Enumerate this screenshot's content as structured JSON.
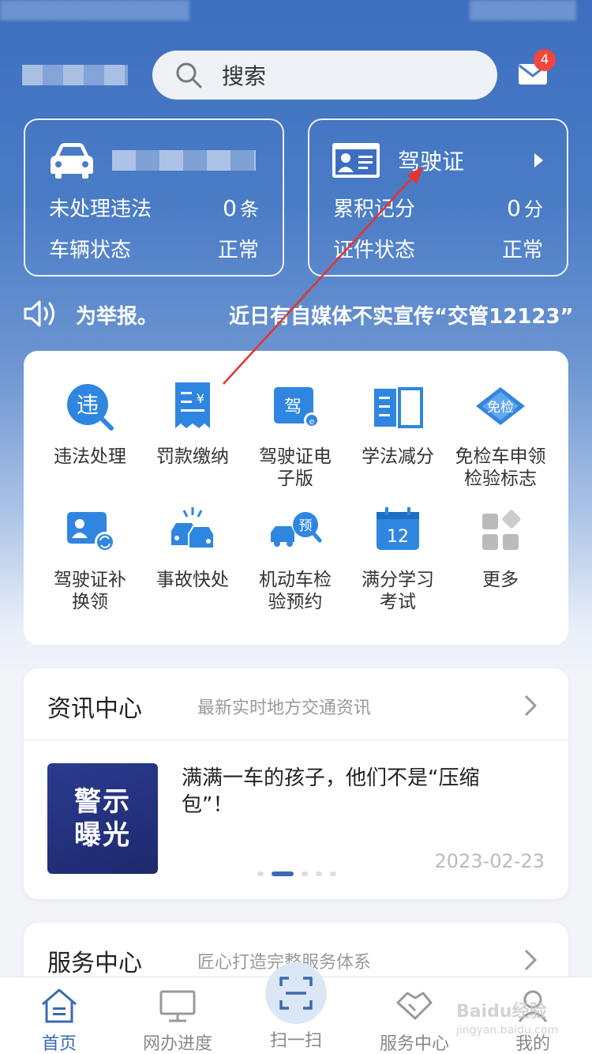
{
  "header": {
    "search_placeholder": "搜索",
    "mail_badge_count": "4"
  },
  "vehicle_card": {
    "violations_label": "未处理违法",
    "violations_count": "0",
    "violations_unit": "条",
    "status_label": "车辆状态",
    "status_value": "正常"
  },
  "license_card": {
    "title": "驾驶证",
    "points_label": "累积记分",
    "points_value": "0",
    "points_unit": "分",
    "status_label": "证件状态",
    "status_value": "正常"
  },
  "notice": {
    "text_a": "为举报。",
    "text_b": "近日有自媒体不实宣传“交管12123”"
  },
  "services": [
    {
      "label": "违法处理",
      "icon": "violation-icon"
    },
    {
      "label": "罚款缴纳",
      "icon": "fine-receipt-icon"
    },
    {
      "label": "驾驶证电子版",
      "icon": "e-license-icon"
    },
    {
      "label": "学法减分",
      "icon": "book-icon"
    },
    {
      "label": "免检车申领检验标志",
      "icon": "exempt-inspection-icon"
    },
    {
      "label": "驾驶证补换领",
      "icon": "license-replace-icon"
    },
    {
      "label": "事故快处",
      "icon": "accident-icon"
    },
    {
      "label": "机动车检验预约",
      "icon": "inspection-booking-icon"
    },
    {
      "label": "满分学习考试",
      "icon": "calendar-12-icon"
    },
    {
      "label": "更多",
      "icon": "more-grid-icon"
    }
  ],
  "service_lines": [
    [
      "违法处理"
    ],
    [
      "罚款缴纳"
    ],
    [
      "驾驶证电",
      "子版"
    ],
    [
      "学法减分"
    ],
    [
      "免检车申领",
      "检验标志"
    ],
    [
      "驾驶证补",
      "换领"
    ],
    [
      "事故快处"
    ],
    [
      "机动车检",
      "验预约"
    ],
    [
      "满分学习",
      "考试"
    ],
    [
      "更多"
    ]
  ],
  "icon_text": {
    "violation": "违",
    "e_license": "驾",
    "exempt": "免检",
    "booking": "预",
    "calendar": "12"
  },
  "news": {
    "title": "资讯中心",
    "subtitle": "最新实时地方交通资讯",
    "thumb_line1": "警示",
    "thumb_line2": "曝光",
    "headline": "满满一车的孩子，他们不是“压缩包”！",
    "date": "2023-02-23"
  },
  "service_center": {
    "title": "服务中心",
    "subtitle": "匠心打造完整服务体系"
  },
  "tabs": [
    {
      "label": "首页",
      "icon": "home-icon",
      "active": true
    },
    {
      "label": "网办进度",
      "icon": "monitor-icon",
      "active": false
    },
    {
      "label": "扫一扫",
      "icon": "scan-icon",
      "active": false
    },
    {
      "label": "服务中心",
      "icon": "handshake-icon",
      "active": false
    },
    {
      "label": "我的",
      "icon": "person-icon",
      "active": false
    }
  ],
  "watermark": {
    "main": "Baidu经验",
    "sub": "jingyan.baidu.com"
  },
  "colors": {
    "accent": "#3b69b5",
    "icon_blue": "#2f86e0",
    "badge_red": "#f2453d",
    "annotation_red": "#e8322b"
  }
}
